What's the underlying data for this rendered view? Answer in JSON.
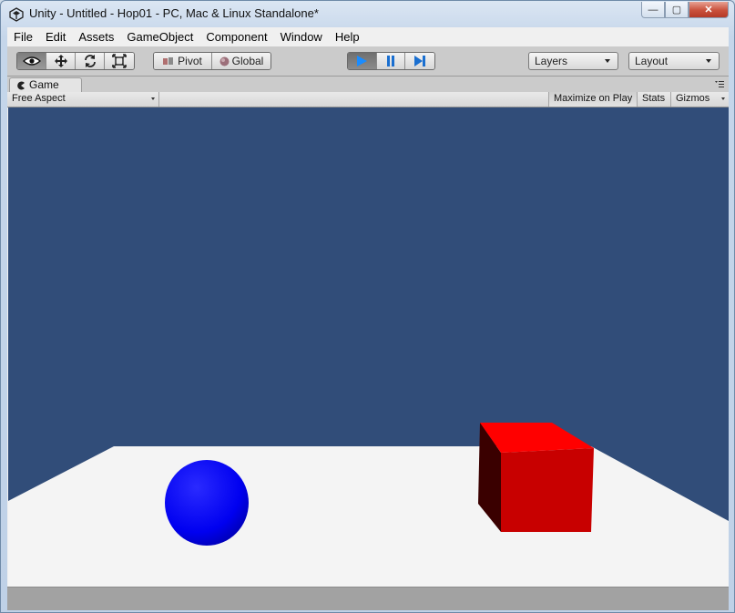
{
  "window": {
    "title": "Unity - Untitled - Hop01 - PC, Mac & Linux Standalone*",
    "controls": {
      "minimize": "—",
      "maximize": "▢",
      "close": "✕"
    }
  },
  "menu": [
    "File",
    "Edit",
    "Assets",
    "GameObject",
    "Component",
    "Window",
    "Help"
  ],
  "toolbar": {
    "tools": [
      "view-eye-icon",
      "move-arrows-icon",
      "rotate-icon",
      "scale-icon"
    ],
    "pivot_label": "Pivot",
    "global_label": "Global",
    "playback": [
      "play-icon",
      "pause-icon",
      "step-icon"
    ],
    "layers_label": "Layers",
    "layout_label": "Layout"
  },
  "tab": {
    "label": "Game"
  },
  "gamebar": {
    "aspect": "Free Aspect",
    "maximize_on_play": "Maximize on Play",
    "stats": "Stats",
    "gizmos": "Gizmos"
  },
  "colors": {
    "sky": "#314d79",
    "floor": "#f4f4f4",
    "sphere": "#0000ff",
    "cube_front": "#c80000",
    "cube_top": "#ff0000",
    "cube_side": "#3a0000",
    "play_accent": "#1a8cff"
  }
}
